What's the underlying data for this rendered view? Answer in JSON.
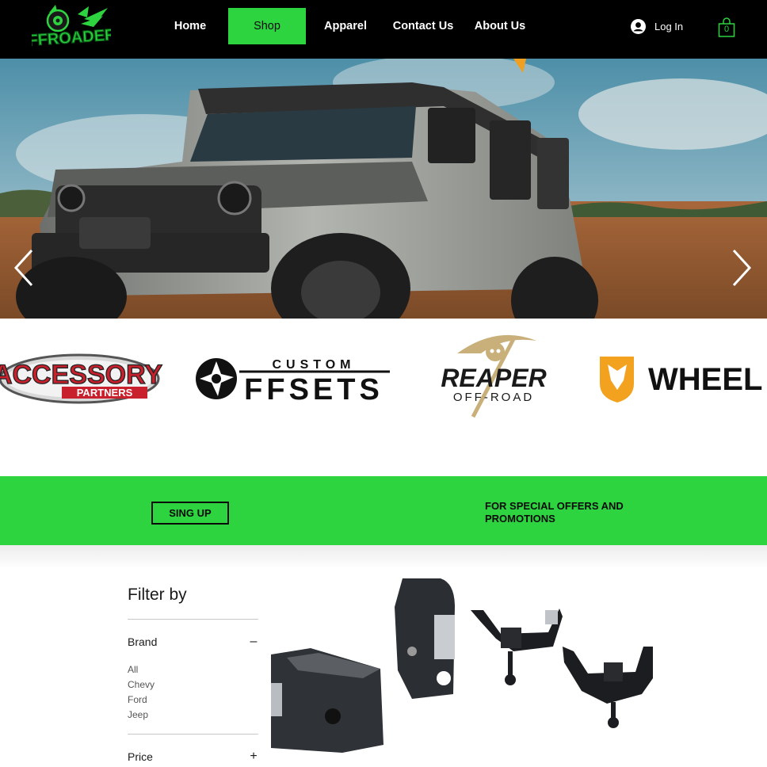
{
  "header": {
    "logo_alt": "OFFROADERS",
    "nav": [
      "Home",
      "Shop",
      "Apparel",
      "Contact Us",
      "About Us"
    ],
    "active_nav": "Shop",
    "login_label": "Log In",
    "cart_count": "0"
  },
  "brands": {
    "accessory_line1": "ACCESSORY",
    "accessory_line2": "PARTNERS",
    "custom_line1": "CUSTOM",
    "custom_line2": "FFSETS",
    "reaper_line1": "REAPER",
    "reaper_line2": "OFF-ROAD",
    "wheel_text": "WHEEL"
  },
  "signup": {
    "button_label": "SING UP",
    "message": "FOR SPECIAL OFFERS AND PROMOTIONS"
  },
  "filter": {
    "title": "Filter by",
    "brand_label": "Brand",
    "brand_toggle": "–",
    "brand_options": [
      "All",
      "Chevy",
      "Ford",
      "Jeep"
    ],
    "price_label": "Price",
    "price_toggle": "+"
  },
  "colors": {
    "accent": "#2ed340",
    "header_bg": "#000000"
  }
}
